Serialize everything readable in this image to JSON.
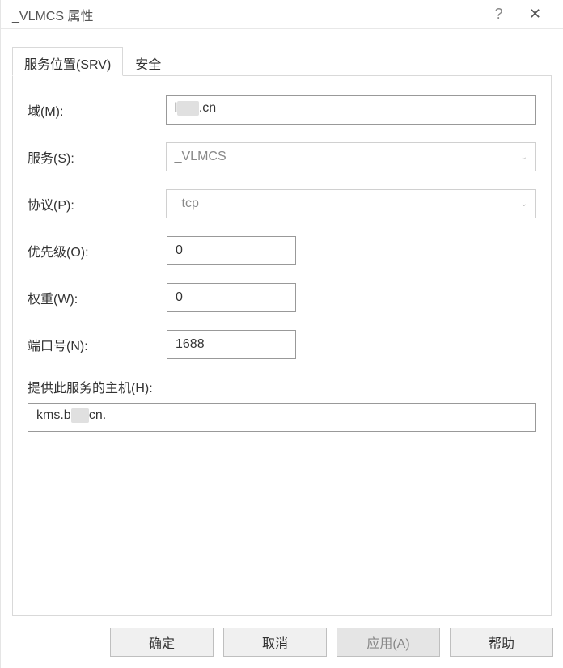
{
  "window": {
    "title": "_VLMCS 属性",
    "help_symbol": "?",
    "close_symbol": "✕"
  },
  "tabs": {
    "srv": "服务位置(SRV)",
    "security": "安全"
  },
  "form": {
    "domain_label": "域(M):",
    "domain_value_prefix": "l",
    "domain_value_suffix": ".cn",
    "service_label": "服务(S):",
    "service_value": "_VLMCS",
    "protocol_label": "协议(P):",
    "protocol_value": "_tcp",
    "priority_label": "优先级(O):",
    "priority_value": "0",
    "weight_label": "权重(W):",
    "weight_value": "0",
    "port_label": "端口号(N):",
    "port_value": "1688",
    "host_label": "提供此服务的主机(H):",
    "host_value_prefix": "kms.b",
    "host_value_suffix": "cn."
  },
  "buttons": {
    "ok": "确定",
    "cancel": "取消",
    "apply": "应用(A)",
    "help": "帮助"
  }
}
